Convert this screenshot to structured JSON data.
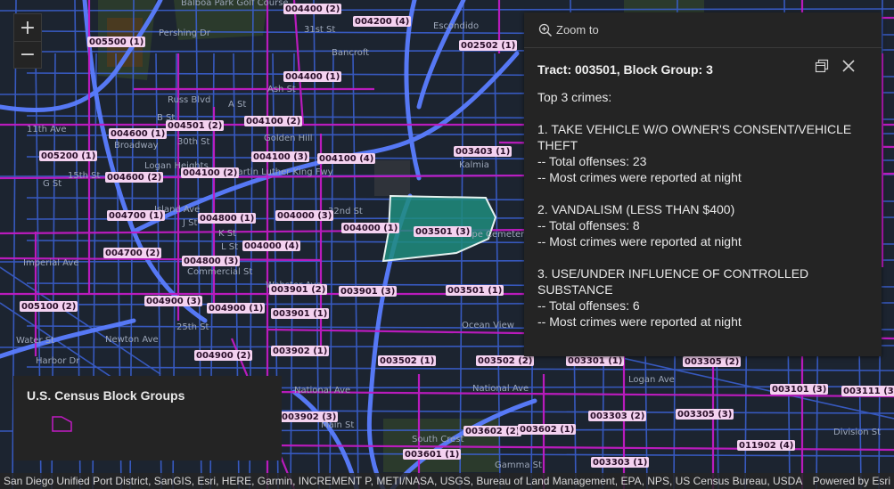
{
  "map": {
    "background": "#1c2430",
    "road_color": "#3a6ff0",
    "boundary_color": "#c21bc4",
    "selected_fill": "#1e8c7d",
    "selected_outline": "#e6f2f0",
    "block_group_labels": [
      "004400 (2)",
      "004200 (4)",
      "005500 (1)",
      "002502 (1)",
      "004400 (1)",
      "004100 (2)",
      "004501 (2)",
      "004600 (1)",
      "005200 (1)",
      "004100 (3)",
      "004100 (4)",
      "003403 (1)",
      "004600 (2)",
      "004100 (2)",
      "004700 (1)",
      "004800 (1)",
      "004000 (3)",
      "004000 (1)",
      "003501 (3)",
      "004000 (4)",
      "004700 (2)",
      "004800 (3)",
      "003901 (2)",
      "003901 (1)",
      "003501 (1)",
      "005100 (2)",
      "004900 (3)",
      "004900 (1)",
      "003901 (3)",
      "003902 (1)",
      "004900 (2)",
      "003502 (1)",
      "003502 (2)",
      "003301 (1)",
      "003305 (2)",
      "003101 (3)",
      "003111 (3)",
      "003902 (3)",
      "003303 (2)",
      "003305 (3)",
      "011902 (4)",
      "003602 (2)",
      "003602 (1)",
      "003601 (1)",
      "003303 (1)"
    ],
    "street_labels": [
      "Balboa Park Golf Course",
      "Pershing Dr",
      "Russ Blvd",
      "A St",
      "Ash St",
      "B St",
      "Broadway",
      "Golden Hill",
      "G St",
      "Logan Heights",
      "Martin Luther King Fwy",
      "Island Ave",
      "J St",
      "K St",
      "L St",
      "Imperial Ave",
      "Commercial St",
      "National Ave",
      "Ocean View",
      "Logan Ave",
      "Harbor Dr",
      "Newton Ave",
      "Main St",
      "South Crest",
      "Gamma St",
      "Division St",
      "Mt Hope Cemetery",
      "Escondido",
      "11th Ave",
      "15th St",
      "30th St",
      "31st St",
      "25th St",
      "32nd St",
      "Water St",
      "National Ave",
      "Webster Ave",
      "Bancroft",
      "Kalmia"
    ]
  },
  "zoom": {
    "in": "+",
    "out": "−"
  },
  "popup": {
    "zoom_to_label": "Zoom to",
    "title": "Tract: 003501, Block Group: 3",
    "intro": "Top 3 crimes:",
    "crimes": [
      {
        "heading": "1. TAKE VEHICLE W/O OWNER'S CONSENT/VEHICLE THEFT",
        "offenses": "-- Total offenses: 23",
        "timing": "-- Most crimes were reported at night"
      },
      {
        "heading": "2. VANDALISM (LESS THAN $400)",
        "offenses": "-- Total offenses: 8",
        "timing": "-- Most crimes were reported at night"
      },
      {
        "heading": "3. USE/UNDER INFLUENCE OF CONTROLLED SUBSTANCE",
        "offenses": "-- Total offenses: 6",
        "timing": "-- Most crimes were reported at night"
      }
    ]
  },
  "legend": {
    "title": "U.S. Census Block Groups",
    "swatch_color": "#c21bc4"
  },
  "attribution": {
    "text": "San Diego Unified Port District, SanGIS, Esri, HERE, Garmin, INCREMENT P, METI/NASA, USGS, Bureau of Land Management, EPA, NPS, US Census Bureau, USDA",
    "powered_by": "Powered by Esri"
  }
}
